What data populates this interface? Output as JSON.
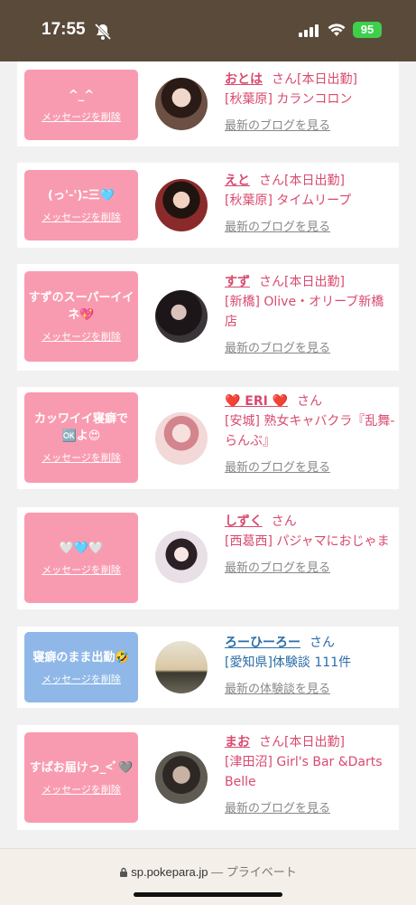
{
  "status": {
    "time": "17:55",
    "battery": "95"
  },
  "cards": [
    {
      "message": "^_^",
      "delete": "メッセージを削除",
      "name": "おとは",
      "san": "さん",
      "badge": "[本日出勤]",
      "shop": "[秋葉原] カランコロン",
      "link": "最新のブログを見る",
      "color": "pink"
    },
    {
      "message": "(っ'-')ﾆ三🩵",
      "delete": "メッセージを削除",
      "name": "えと",
      "san": "さん",
      "badge": "[本日出勤]",
      "shop": "[秋葉原] タイムリープ",
      "link": "最新のブログを見る",
      "color": "pink"
    },
    {
      "message": "すずのスーパーイイネ💖",
      "delete": "メッセージを削除",
      "name": "すず",
      "san": "さん",
      "badge": "[本日出勤]",
      "shop": "[新橋] Olive・オリーブ新橋店",
      "link": "最新のブログを見る",
      "color": "pink"
    },
    {
      "message": "カッワイイ寝癖で🆗よ😍",
      "delete": "メッセージを削除",
      "name": "❤️ ERI ❤️",
      "san": "さん",
      "badge": "",
      "shop": "[安城] 熟女キャバクラ『乱舞-らんぶ』",
      "link": "最新のブログを見る",
      "color": "pink"
    },
    {
      "message": "🤍🩵🤍",
      "delete": "メッセージを削除",
      "name": "しずく",
      "san": "さん",
      "badge": "",
      "shop": "[西葛西] パジャマにおじゃま",
      "link": "最新のブログを見る",
      "color": "pink"
    },
    {
      "message": "寝癖のまま出勤🤣",
      "delete": "メッセージを削除",
      "name": "ろーひーろー",
      "san": "さん",
      "badge": "",
      "shop": "[愛知県]体験談 111件",
      "link": "最新の体験談を見る",
      "color": "blue"
    },
    {
      "message": "すぱお届けっ_<ﾞ🩶",
      "delete": "メッセージを削除",
      "name": "まお",
      "san": "さん",
      "badge": "[本日出勤]",
      "shop": "[津田沼] Girl's Bar &Darts Belle",
      "link": "最新のブログを見る",
      "color": "pink"
    }
  ],
  "browser": {
    "domain": "sp.pokepara.jp",
    "privacy": "— プライベート"
  }
}
